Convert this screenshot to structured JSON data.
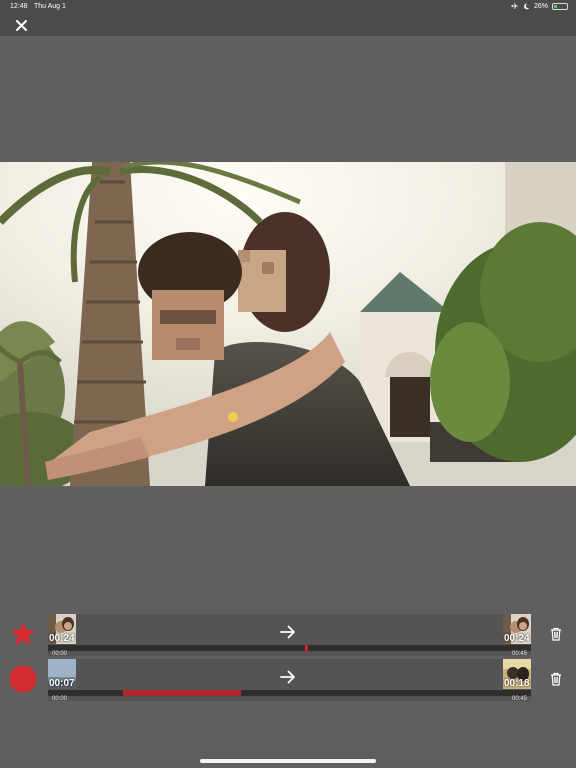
{
  "status_bar": {
    "time": "12:48",
    "date": "Thu Aug 1",
    "battery_percent_label": "26%",
    "battery_level": 0.26,
    "battery_color": "#4cd964",
    "icons": [
      "airplane-icon",
      "moon-icon",
      "battery-icon"
    ]
  },
  "top_bar": {
    "close_icon": "close-icon"
  },
  "photo": {
    "description_icon": "photo-image"
  },
  "accent_color": "#d22a2e",
  "clips": [
    {
      "marker_icon": "star-icon",
      "start_thumb_time": "00:24",
      "end_thumb_time": "00:24",
      "arrow_icon": "arrow-right-icon",
      "scale_start": "00:00",
      "scale_end": "00:45",
      "selection_start_s": 24,
      "selection_end_s": 24,
      "duration_s": 45,
      "trash_icon": "trash-icon"
    },
    {
      "marker_icon": "record-dot-icon",
      "start_thumb_time": "00:07",
      "end_thumb_time": "00:18",
      "arrow_icon": "arrow-right-icon",
      "scale_start": "00:00",
      "scale_end": "00:45",
      "selection_start_s": 7,
      "selection_end_s": 18,
      "duration_s": 45,
      "trash_icon": "trash-icon"
    }
  ]
}
